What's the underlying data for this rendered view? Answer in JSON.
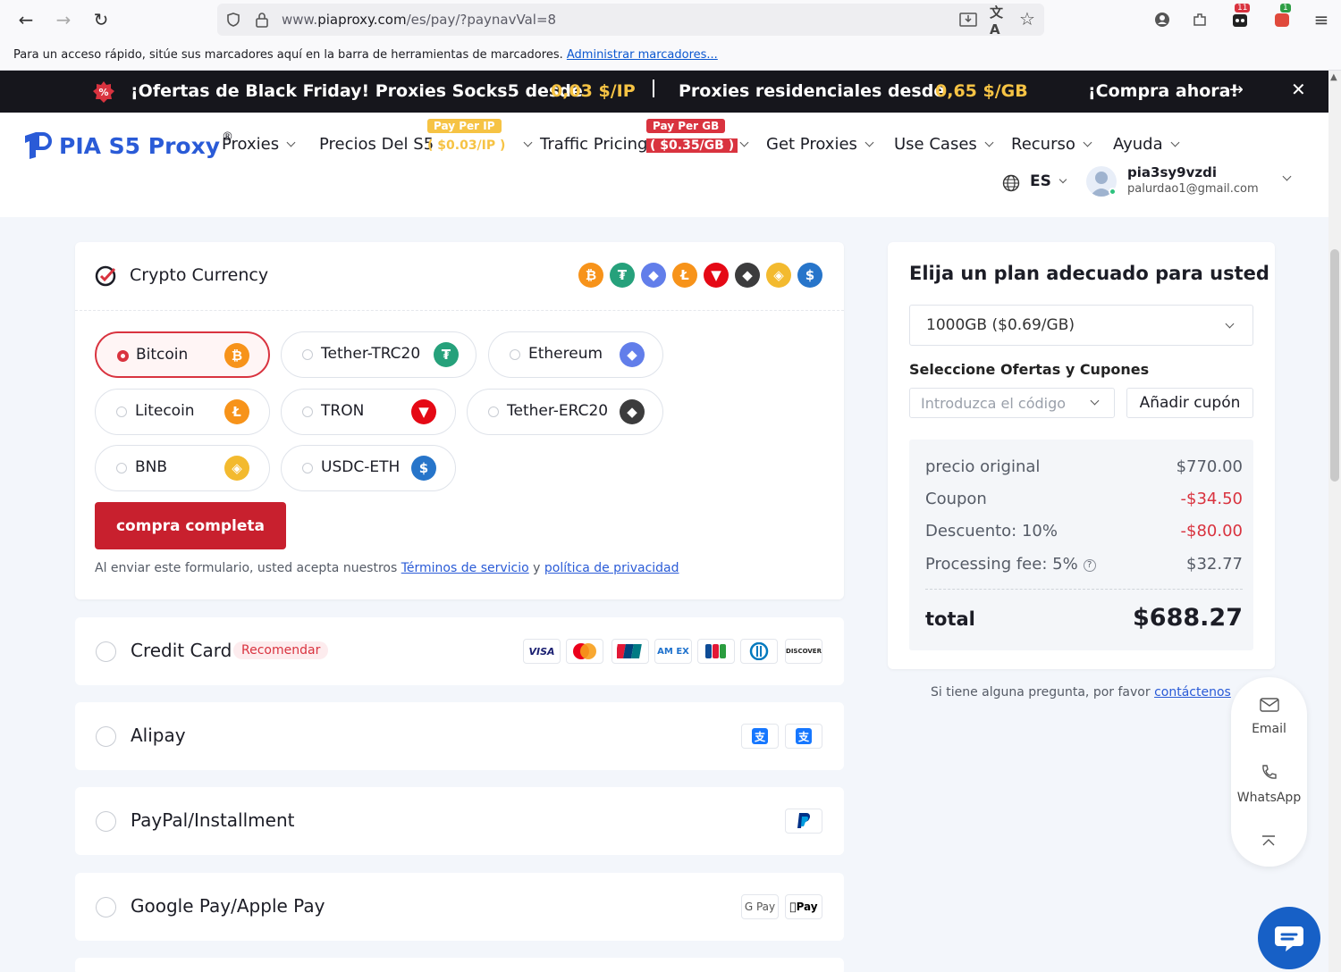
{
  "browser": {
    "url_prefix": "www.",
    "url_host": "piaproxy.com",
    "url_path": "/es/pay/?paynavVal=8",
    "badge_1": "11",
    "badge_2": "1"
  },
  "bookmarks_bar": {
    "text": "Para un acceso rápido, sitúe sus marcadores aquí en la barra de herramientas de marcadores.",
    "link": "Administrar marcadores..."
  },
  "promo": {
    "text1": "¡Ofertas de Black Friday! Proxies Socks5 desde",
    "price1": "0,03 $/IP",
    "text2": "Proxies residenciales desde",
    "price2": "0,65 $/GB",
    "cta": "¡Compra ahora!"
  },
  "header": {
    "logo_text": "PIA S5 Proxy",
    "logo_reg": "®",
    "menu": [
      "Proxies",
      "Precios Del S5",
      "Traffic Pricing",
      "Get Proxies",
      "Use Cases",
      "Recurso",
      "Ayuda"
    ],
    "tag_ip_top": "Pay Per IP",
    "tag_ip_bottom": "( $0.03/IP )",
    "tag_gb_top": "Pay Per GB",
    "tag_gb_bottom": "( $0.35/GB )",
    "lang": "ES",
    "user_name": "pia3sy9vzdi",
    "user_email": "palurdao1@gmail.com"
  },
  "crypto": {
    "title": "Crypto Currency",
    "options": [
      "Bitcoin",
      "Tether-TRC20",
      "Ethereum",
      "Litecoin",
      "TRON",
      "Tether-ERC20",
      "BNB",
      "USDC-ETH"
    ],
    "selected": "Bitcoin",
    "submit": "compra completa",
    "terms_prefix": "Al enviar este formulario, usted acepta nuestros",
    "terms_link": "Términos de servicio",
    "terms_and": "y",
    "privacy_link": "política de privacidad"
  },
  "payment_methods": {
    "credit_card": "Credit Card",
    "recommend": "Recomendar",
    "alipay": "Alipay",
    "paypal": "PayPal/Installment",
    "gpay": "Google Pay/Apple Pay",
    "card_logos": [
      "VISA",
      "AM EX",
      "DISCOVER"
    ],
    "gpay_logo": "G Pay",
    "apple_logo": "Pay"
  },
  "summary": {
    "title": "Elija un plan adecuado para usted",
    "plan": "1000GB ($0.69/GB)",
    "coupon_title": "Seleccione Ofertas y Cupones",
    "coupon_placeholder": "Introduzca el código",
    "coupon_button": "Añadir cupón",
    "rows": [
      {
        "label": "precio original",
        "value": "$770.00"
      },
      {
        "label": "Coupon",
        "value": "-$34.50"
      },
      {
        "label": "Descuento: 10%",
        "value": "-$80.00"
      },
      {
        "label": "Processing fee: 5%",
        "value": "$32.77"
      }
    ],
    "total_label": "total",
    "total_value": "$688.27",
    "question_text": "Si tiene alguna pregunta, por favor",
    "contact_link": "contáctenos"
  },
  "float_panel": {
    "email": "Email",
    "whatsapp": "WhatsApp"
  },
  "colors": {
    "accent_red": "#d9333f",
    "promo_bg": "#16161c",
    "promo_gold": "#f6c344",
    "brand_blue": "#2a5bd7"
  }
}
